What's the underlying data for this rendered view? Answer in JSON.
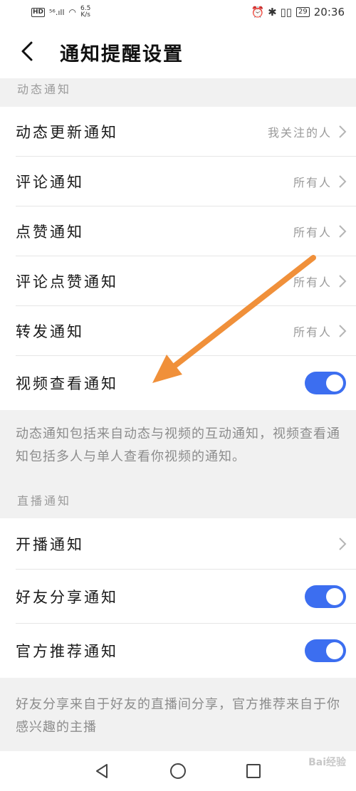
{
  "status_bar": {
    "left_hd": "HD",
    "left_signal": "⁵⁶.ıll",
    "left_wifi": "◠",
    "speed_value": "6.5",
    "speed_unit": "K/s",
    "right_icons": "⏰ ✱ ▯▯",
    "battery": "29",
    "time": "20:36"
  },
  "header": {
    "title": "通知提醒设置",
    "back_icon": "chevron-left-icon"
  },
  "section_dynamic": {
    "label": "动态通知",
    "rows": [
      {
        "label": "动态更新通知",
        "value": "我关注的人",
        "control": "chevron"
      },
      {
        "label": "评论通知",
        "value": "所有人",
        "control": "chevron"
      },
      {
        "label": "点赞通知",
        "value": "所有人",
        "control": "chevron"
      },
      {
        "label": "评论点赞通知",
        "value": "所有人",
        "control": "chevron"
      },
      {
        "label": "转发通知",
        "value": "所有人",
        "control": "chevron"
      },
      {
        "label": "视频查看通知",
        "value": "",
        "control": "toggle",
        "on": true
      }
    ],
    "note": "动态通知包括来自动态与视频的互动通知，视频查看通知包括多人与单人查看你视频的通知。"
  },
  "section_live": {
    "label": "直播通知",
    "rows": [
      {
        "label": "开播通知",
        "value": "",
        "control": "chevron"
      },
      {
        "label": "好友分享通知",
        "value": "",
        "control": "toggle",
        "on": true
      },
      {
        "label": "官方推荐通知",
        "value": "",
        "control": "toggle",
        "on": true
      }
    ],
    "note": "好友分享来自于好友的直播间分享，官方推荐来自于你感兴趣的主播"
  },
  "nav_bar": {
    "back_icon": "triangle-back-icon",
    "home_icon": "circle-home-icon",
    "recent_icon": "square-recent-icon"
  },
  "watermark": "Bai经验",
  "colors": {
    "toggle_on": "#3c6ef0",
    "annotation_arrow": "#f0903a",
    "page_bg": "#f1f1f1"
  }
}
